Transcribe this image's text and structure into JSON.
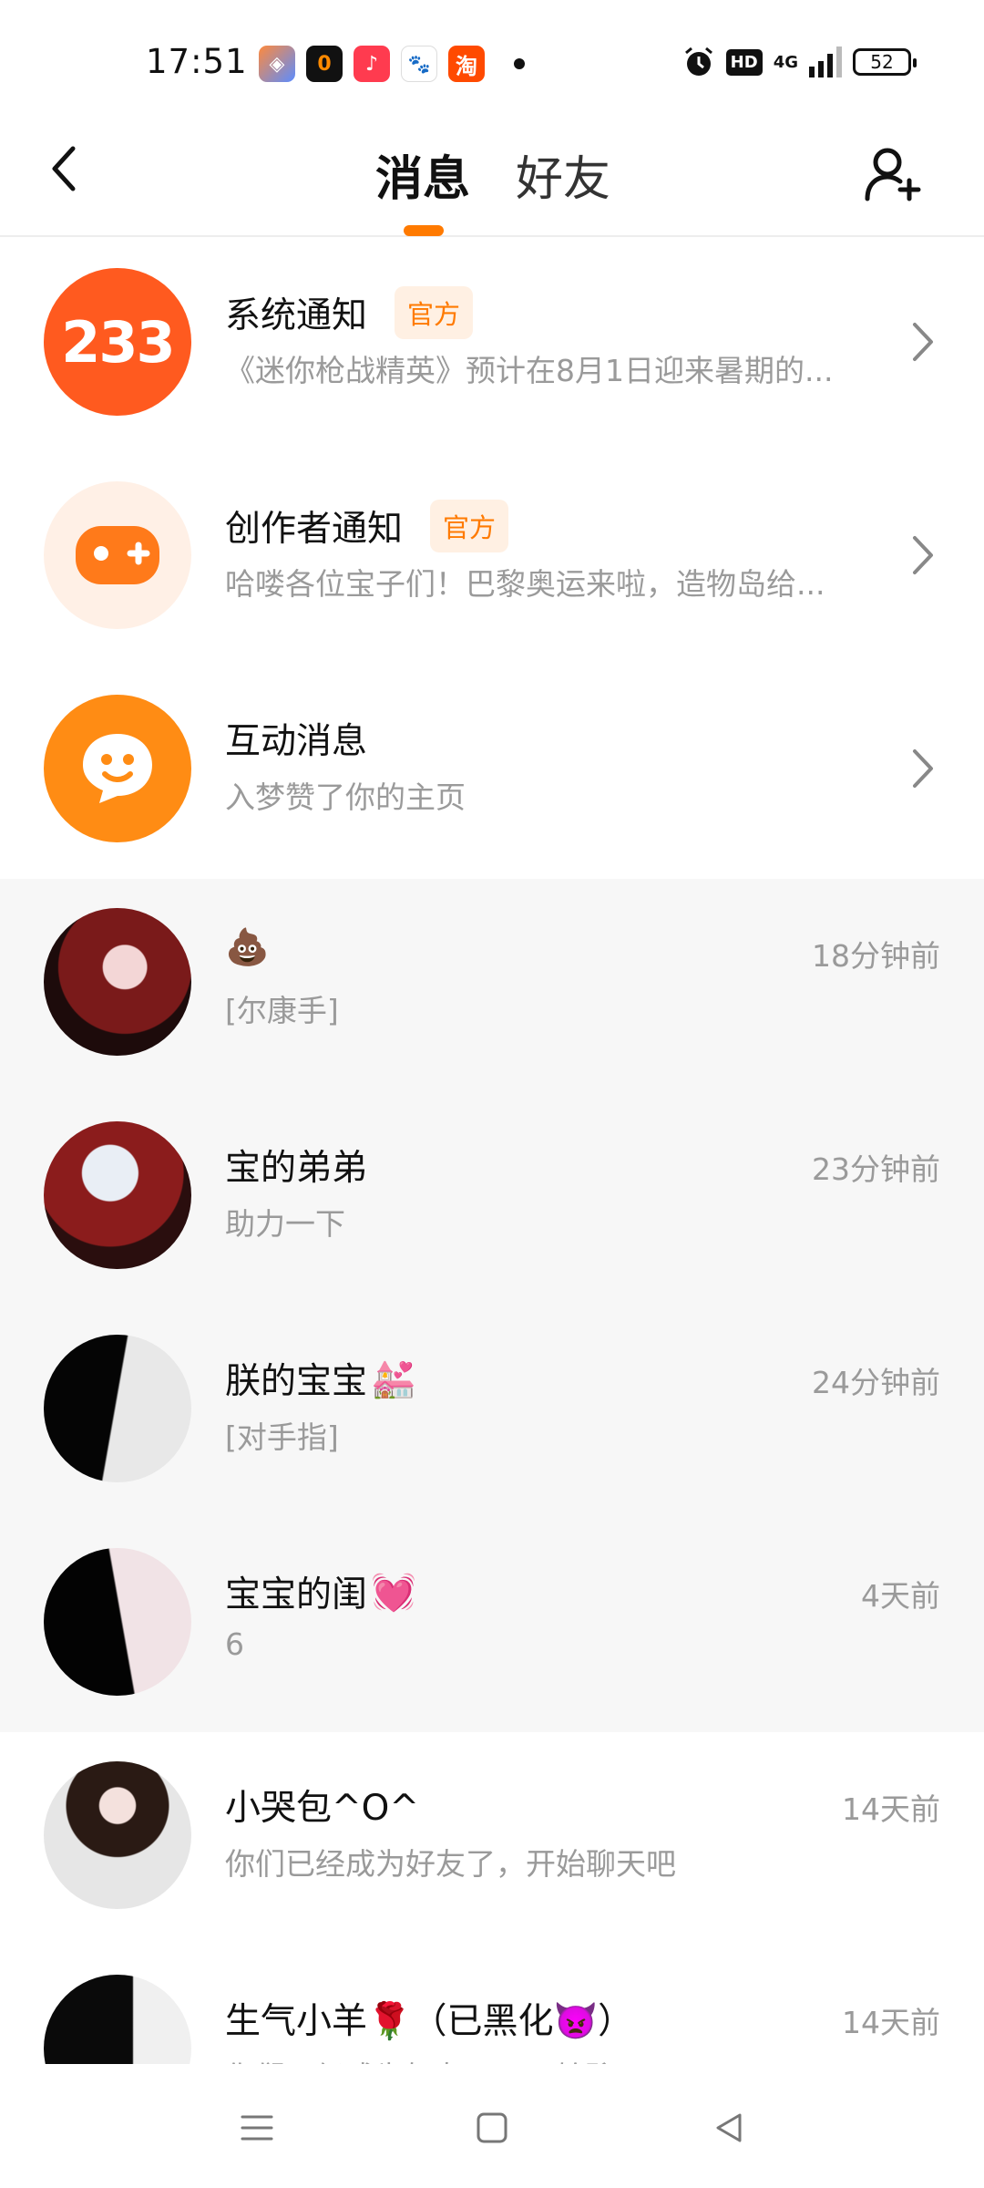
{
  "status_bar": {
    "time": "17:51",
    "notif_icons": [
      {
        "name": "app-icon-1",
        "glyph": "◈"
      },
      {
        "name": "app-icon-2",
        "glyph": "0"
      },
      {
        "name": "music-app-icon",
        "glyph": "♪"
      },
      {
        "name": "baidu-app-icon",
        "glyph": "🐾"
      },
      {
        "name": "taobao-app-icon",
        "glyph": "淘"
      }
    ],
    "hd": "HD",
    "network": "4G",
    "battery": "52"
  },
  "header": {
    "tab_messages": "消息",
    "tab_friends": "好友",
    "accent_color": "#ff7a00"
  },
  "rows": [
    {
      "title": "系统通知",
      "badge": "官方",
      "subtitle": "《迷你枪战精英》预计在8月1日迎来暑期的...",
      "avatar_text": "233"
    },
    {
      "title": "创作者通知",
      "badge": "官方",
      "subtitle": "哈喽各位宝子们！巴黎奥运来啦，造物岛给..."
    },
    {
      "title": "互动消息",
      "subtitle": "入梦赞了你的主页"
    },
    {
      "title": "💩",
      "subtitle": "[尔康手]",
      "time": "18分钟前"
    },
    {
      "title": "宝的弟弟",
      "subtitle": "助力一下",
      "time": "23分钟前"
    },
    {
      "title": "朕的宝宝",
      "title_emoji": "💒",
      "subtitle": "[对手指]",
      "time": "24分钟前"
    },
    {
      "title": "宝宝的闺",
      "title_emoji": "💓",
      "subtitle": "6",
      "time": "4天前"
    },
    {
      "title": "小哭包^O^",
      "subtitle": "你们已经成为好友了，开始聊天吧",
      "time": "14天前"
    },
    {
      "title": "生气小羊🌹（已黑化👿）",
      "subtitle": "你们已经成为好友了，开始聊天吧",
      "time": "14天前"
    }
  ]
}
